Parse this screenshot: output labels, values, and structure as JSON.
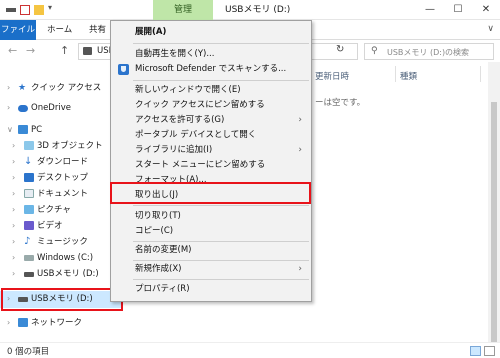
{
  "window": {
    "manage_tab": "管理",
    "title": "USBメモリ (D:)",
    "minimize": "—",
    "maximize": "☐",
    "close": "✕"
  },
  "ribbon": {
    "tabs": [
      "ファイル",
      "ホーム",
      "共有"
    ],
    "expand_icon": "∨"
  },
  "address": {
    "back": "←",
    "forward": "→",
    "up": "↑",
    "path_text": "USB",
    "refresh": "↻",
    "search_placeholder": "USBメモリ (D:)の検索"
  },
  "nav": {
    "items": [
      {
        "label": "クイック アクセス",
        "chev": "›",
        "icon": "star-icon"
      },
      {
        "label": "OneDrive",
        "chev": "›",
        "icon": "cloud-icon"
      },
      {
        "label": "PC",
        "chev": "∨",
        "icon": "pc-icon"
      },
      {
        "label": "3D オブジェクト",
        "chev": "›",
        "icon": "3d-objects-icon"
      },
      {
        "label": "ダウンロード",
        "chev": "›",
        "icon": "download-icon"
      },
      {
        "label": "デスクトップ",
        "chev": "›",
        "icon": "desktop-icon"
      },
      {
        "label": "ドキュメント",
        "chev": "›",
        "icon": "documents-icon"
      },
      {
        "label": "ピクチャ",
        "chev": "›",
        "icon": "pictures-icon"
      },
      {
        "label": "ビデオ",
        "chev": "›",
        "icon": "videos-icon"
      },
      {
        "label": "ミュージック",
        "chev": "›",
        "icon": "music-icon"
      },
      {
        "label": "Windows (C:)",
        "chev": "›",
        "icon": "drive-c-icon"
      },
      {
        "label": "USBメモリ (D:)",
        "chev": "›",
        "icon": "usb-drive-icon"
      },
      {
        "label": "USBメモリ (D:)",
        "chev": "›",
        "icon": "usb-drive-icon"
      },
      {
        "label": "ネットワーク",
        "chev": "›",
        "icon": "network-icon"
      }
    ]
  },
  "content": {
    "columns": [
      "更新日時",
      "種類"
    ],
    "empty_message": "ーは空です。"
  },
  "status": {
    "item_count": "0 個の項目"
  },
  "context_menu": {
    "items": [
      {
        "label": "展開(A)"
      },
      {
        "label": "自動再生を開く(Y)..."
      },
      {
        "label": "Microsoft Defender でスキャンする..."
      },
      {
        "label": "新しいウィンドウで開く(E)"
      },
      {
        "label": "クイック アクセスにピン留めする"
      },
      {
        "label": "アクセスを許可する(G)",
        "submenu": "›"
      },
      {
        "label": "ポータブル デバイスとして開く"
      },
      {
        "label": "ライブラリに追加(I)",
        "submenu": "›"
      },
      {
        "label": "スタート メニューにピン留めする"
      },
      {
        "label": "フォーマット(A)..."
      },
      {
        "label": "取り出し(J)"
      },
      {
        "label": "切り取り(T)"
      },
      {
        "label": "コピー(C)"
      },
      {
        "label": "名前の変更(M)"
      },
      {
        "label": "新規作成(X)",
        "submenu": "›"
      },
      {
        "label": "プロパティ(R)"
      }
    ]
  },
  "colors": {
    "accent_blue": "#1a6fc9",
    "manage_tab_bg": "#bfe6a8",
    "highlight_red": "#e8131a",
    "selected_bg": "#cce8ff"
  }
}
